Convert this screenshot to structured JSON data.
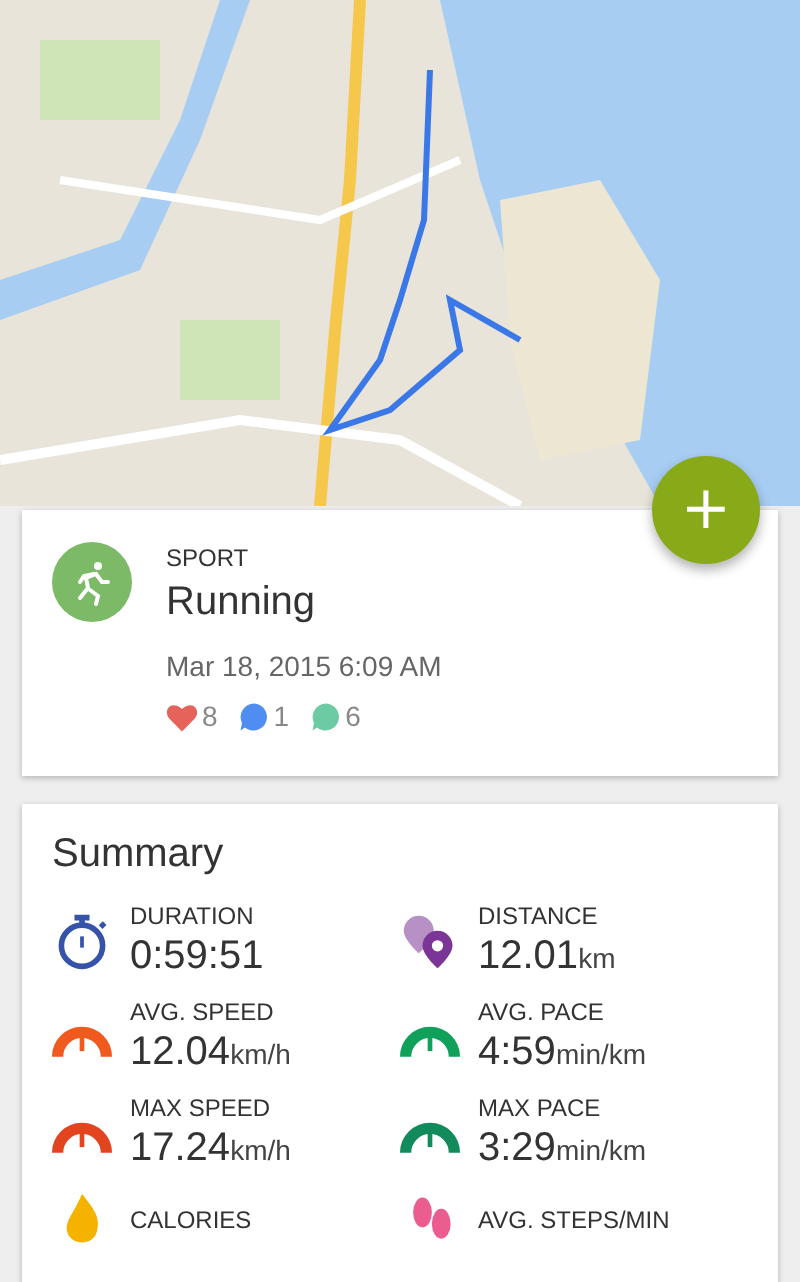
{
  "fab": {
    "label": "+"
  },
  "activity": {
    "category": "SPORT",
    "name": "Running",
    "date": "Mar 18, 2015 6:09 AM",
    "counts": [
      {
        "kind": "like",
        "value": "8",
        "color": "#e5635a"
      },
      {
        "kind": "peptalk",
        "value": "1",
        "color": "#4f8ef0"
      },
      {
        "kind": "comment",
        "value": "6",
        "color": "#6dcba3"
      }
    ]
  },
  "summary": {
    "title": "Summary",
    "stats": [
      {
        "kind": "stopwatch",
        "label": "DURATION",
        "value": "0:59:51",
        "color": "#3553a8"
      },
      {
        "kind": "pins",
        "label": "DISTANCE",
        "value": "12.01",
        "unit": "km",
        "color": "#7b3596"
      },
      {
        "kind": "gauge",
        "label": "AVG. SPEED",
        "value": "12.04",
        "unit": "km/h",
        "color": "#f05a1e"
      },
      {
        "kind": "gauge",
        "label": "AVG. PACE",
        "value": "4:59",
        "unit": "min/km",
        "color": "#11a05a"
      },
      {
        "kind": "gauge",
        "label": "MAX SPEED",
        "value": "17.24",
        "unit": "km/h",
        "color": "#e24420"
      },
      {
        "kind": "gauge",
        "label": "MAX PACE",
        "value": "3:29",
        "unit": "min/km",
        "color": "#138a5c"
      },
      {
        "kind": "flame",
        "label": "CALORIES",
        "color": "#f5b300"
      },
      {
        "kind": "steps",
        "label": "AVG. STEPS/MIN",
        "color": "#ec5d8f"
      }
    ]
  }
}
